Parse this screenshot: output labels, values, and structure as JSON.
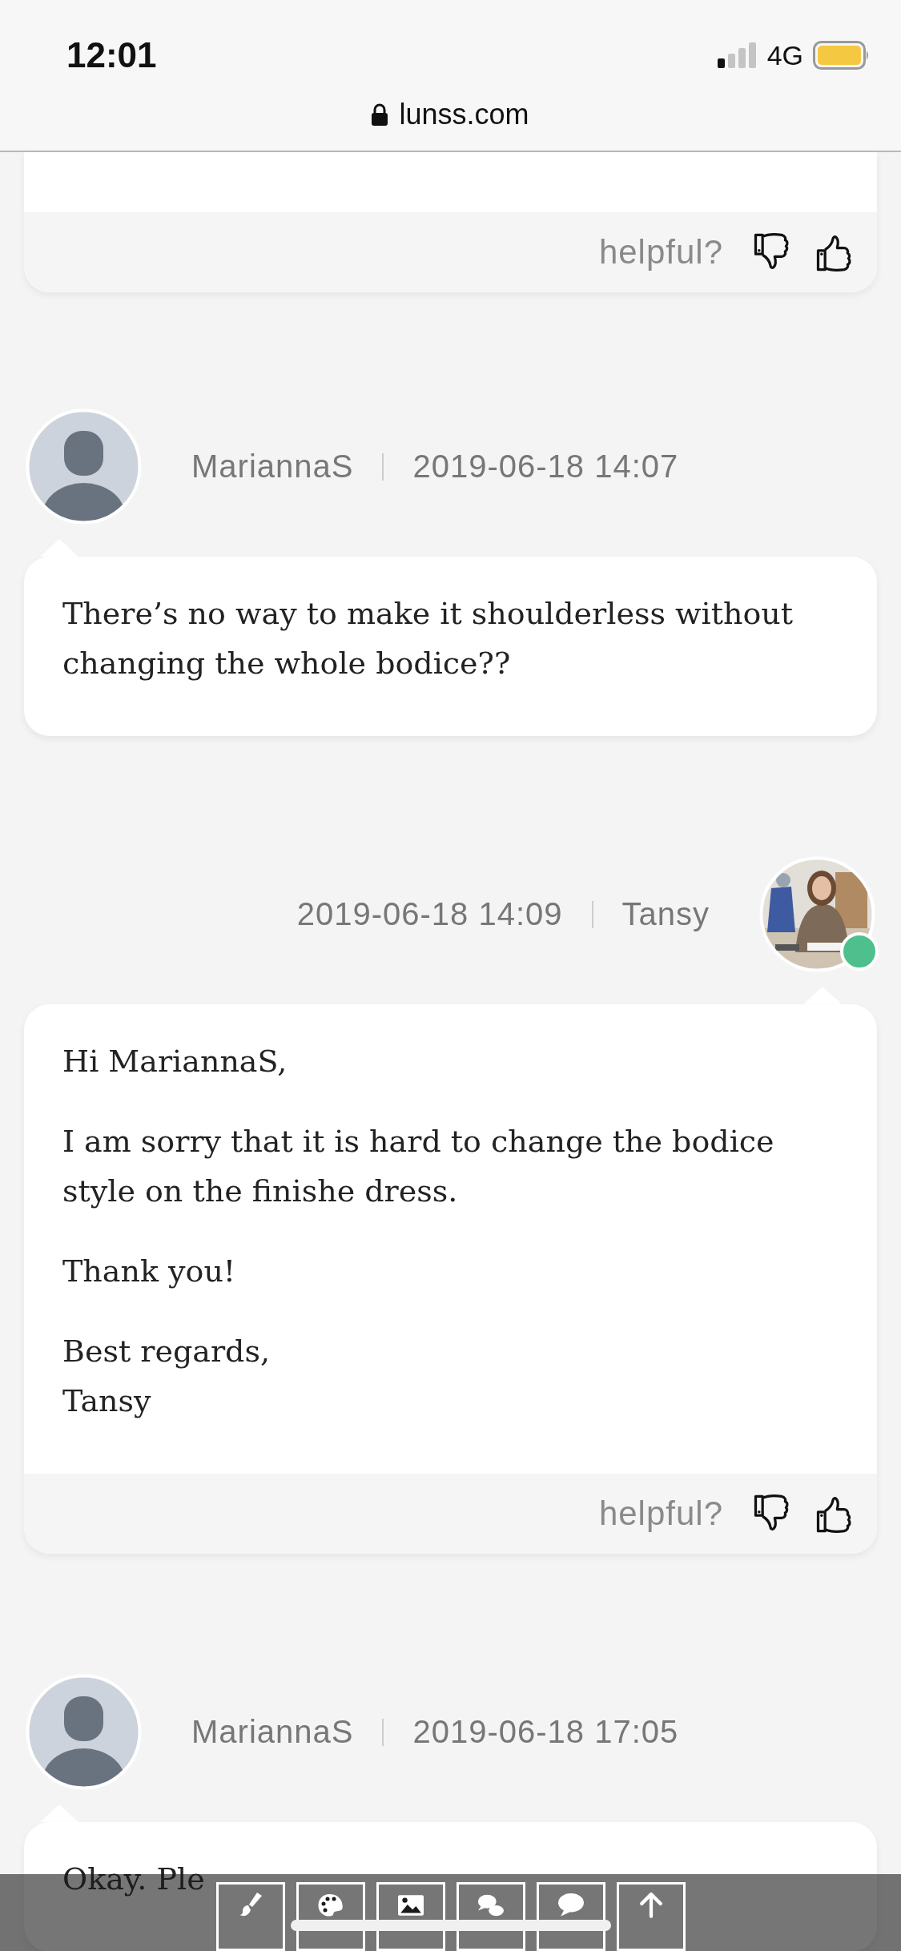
{
  "status_bar": {
    "time": "12:01",
    "network": "4G"
  },
  "address_bar": {
    "url": "lunss.com"
  },
  "messages": [
    {
      "kind": "fragment",
      "helpful_label": "helpful?"
    },
    {
      "kind": "customer",
      "author": "MariannaS",
      "timestamp": "2019-06-18 14:07",
      "online": false,
      "paragraphs": [
        "There’s no way to make it shoulderless without changing the whole bodice??"
      ]
    },
    {
      "kind": "staff",
      "author": "Tansy",
      "timestamp": "2019-06-18 14:09",
      "online": true,
      "paragraphs": [
        "Hi MariannaS,",
        "I am sorry that it is hard to change the bodice style on the finishe dress.",
        "Thank you!",
        "Best regards,\nTansy"
      ],
      "helpful_label": "helpful?"
    },
    {
      "kind": "customer",
      "author": "MariannaS",
      "timestamp": "2019-06-18 17:05",
      "online": false,
      "paragraphs": [
        "Okay. Ple"
      ]
    }
  ]
}
